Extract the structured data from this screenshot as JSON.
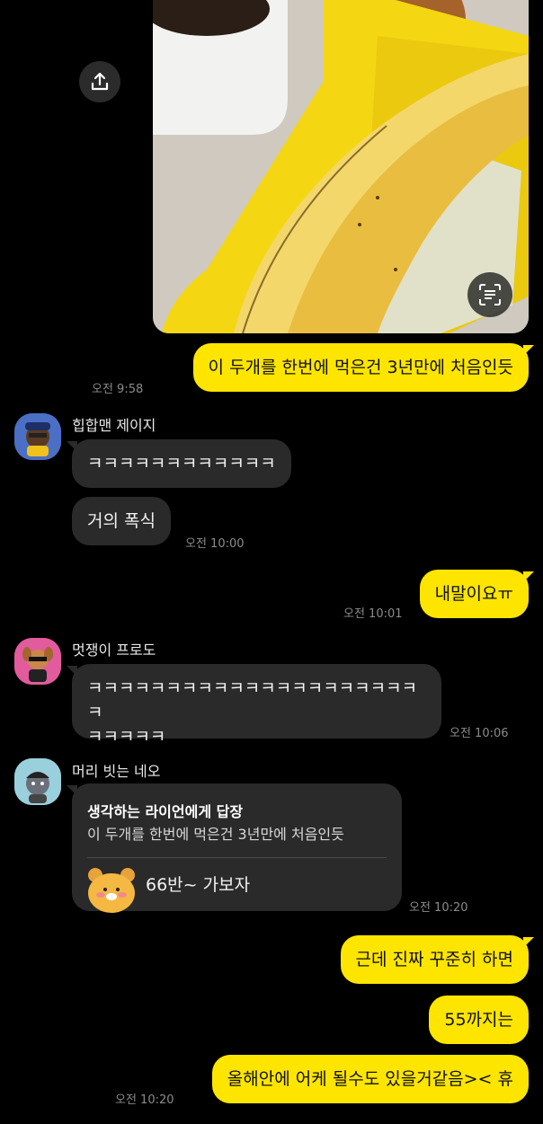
{
  "photo": {
    "description_icon": "banana-photo"
  },
  "icons": {
    "share": "share-icon",
    "scan": "text-scan-icon"
  },
  "messages": {
    "m1": {
      "text": "이 두개를 한번에 먹은건 3년만에 처음인듯",
      "time": "오전 9:58"
    },
    "jeiji": {
      "name": "힙합맨 제이지",
      "b1": "ㅋㅋㅋㅋㅋㅋㅋㅋㅋㅋㅋㅋ",
      "b2": "거의 폭식",
      "time": "오전 10:00"
    },
    "m2": {
      "text": "내말이요ㅠ",
      "time": "오전 10:01"
    },
    "frodo": {
      "name": "멋쟁이 프로도",
      "line1": "ㅋㅋㅋㅋㅋㅋㅋㅋㅋㅋㅋㅋㅋㅋㅋㅋㅋㅋㅋㅋㅋㅋ",
      "line2": "ㅋㅋㅋㅋㅋ",
      "time": "오전 10:06"
    },
    "neo": {
      "name": "머리 빗는 네오",
      "reply_head": "생각하는 라이언에게 답장",
      "reply_quote": "이 두개를 한번에 먹은건 3년만에 처음인듯",
      "text": "66반~ 가보자",
      "time": "오전 10:20"
    },
    "m3": {
      "text": "근데 진짜 꾸준히 하면"
    },
    "m4": {
      "text": "55까지는"
    },
    "m5": {
      "text": "올해안에 어케 될수도 있을거같음>< 휴",
      "time": "오전 10:20"
    }
  },
  "colors": {
    "my_bubble": "#fee500",
    "their_bubble": "#2a2a2a",
    "background": "#000000"
  }
}
